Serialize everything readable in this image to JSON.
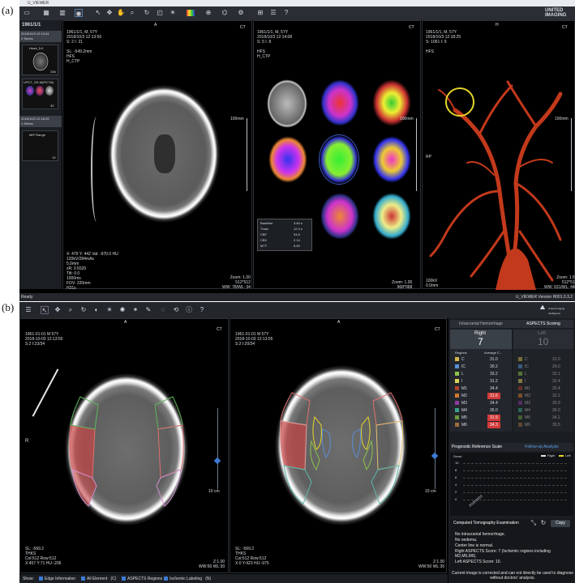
{
  "labels": {
    "a": "(a)",
    "b": "(b)"
  },
  "panel_a": {
    "app_title": "U_VIEWER",
    "brand_line1": "UNITED",
    "brand_line2": "IMAGING",
    "study_date": "1961/1/1",
    "series1": {
      "date": "2018/10/3 12:13:04",
      "count": "2 Series"
    },
    "thumbs": [
      {
        "label": "Head_5.0",
        "num": "236"
      },
      {
        "label": "UPCT_SS-M(PICTA)",
        "num": "33"
      },
      {
        "label": "MIP Range",
        "num": "13"
      }
    ],
    "series2": {
      "date": "2018/10/3 12:16:25",
      "count": "1 Series"
    },
    "view1": {
      "orient_top": "A",
      "orient_corner": "CT",
      "info": "1961/1/1, M, 57Y\n2018/10/3 12:13:56\nS: 2 I: 21\n\nSL: -549.2mm\nHFS\nH_CTP",
      "bottom_left": "X: 479 Y: 442 Val: -970.0 HU\n120kV/284mAs\n5.0mm\nzR: 0.5520\nTilt: 0.0\n1000ms\nFOV: 220mm\nH31s",
      "bottom_right": "Zoom: 1.00\n512*512\nWW: 78/WL: 34",
      "scale": "100mm"
    },
    "view2": {
      "orient_corner": "CT",
      "info": "1961/1/1, M, 57Y\n2018/10/3 12:14:08\nS: 5 I: 8\n\nHFS\nH_CTP",
      "bottom_right": "Zoom: 1.00\n968*968",
      "scale": "100mm",
      "table": [
        [
          "Baseline",
          "3.84 s"
        ],
        [
          "Tmax",
          "12.3 s"
        ],
        [
          "CBF",
          "34.8"
        ],
        [
          "CBV",
          "2.14"
        ],
        [
          "MTT",
          "6.50"
        ]
      ]
    },
    "view3": {
      "orient_top": "H",
      "orient_corner": "CT",
      "info": "1961/1/1, M, 57Y\n2018/10/3 12:18:25\nS: 1061 I: 9\n\nHFS",
      "bottom_left": "100kV\n0.0mm",
      "bottom_right": "Zoom: 1.51\n512*512\nWW: 631/WL: 444",
      "side": "RP",
      "scale": "100mm"
    },
    "status": "Ready",
    "version": "U_VIEWER Version R001.0.3.2"
  },
  "panel_b": {
    "brand": "United Imaging Intelligence",
    "left_view": {
      "orient_top": "A",
      "orient_corner": "CT",
      "info": "1961-01-01 M 57Y\n2018-10-03 12:13:55\nS:2 I:23/34",
      "side": "R",
      "scale": "10 cm",
      "bottom_left": "SL: -569.2\nTHKS\nCol:512 Row:512\nX:457 Y:71 HU:-206",
      "bottom_right": "Z:1.00\nWW:50 WL:30"
    },
    "right_view": {
      "orient_top": "A",
      "orient_corner": "CT",
      "info": "1961-01-01 M 57Y\n2018-10-03 12:13:55\nS:2 I:20/34",
      "side": "R",
      "scale": "10 cm",
      "bottom_left": "SL: -569.2\nTHKS\nCol:512 Row:512\nX:0 Y:423 HU:-975",
      "bottom_right": "Z:1.00\nWW:50 WL:30"
    },
    "tabs": [
      "Intracranial Hemorrhage",
      "ASPECTS Scoring"
    ],
    "right_score": {
      "label": "Right",
      "value": "7"
    },
    "left_score": {
      "label": "Left",
      "value": "10"
    },
    "col_headers": [
      "Regions",
      "Average C..."
    ],
    "rows_right": [
      [
        "C",
        "31.0",
        "normal"
      ],
      [
        "IC",
        "30.2",
        "normal"
      ],
      [
        "L",
        "33.2",
        "normal"
      ],
      [
        "I",
        "31.2",
        "normal"
      ],
      [
        "M1",
        "34.4",
        "normal"
      ],
      [
        "M2",
        "31.6",
        "flag"
      ],
      [
        "M3",
        "34.4",
        "normal"
      ],
      [
        "M4",
        "35.0",
        "normal"
      ],
      [
        "M5",
        "31.9",
        "flag"
      ],
      [
        "M6",
        "34.3",
        "flag"
      ]
    ],
    "rows_left": [
      [
        "C",
        "31.0"
      ],
      [
        "IC",
        "29.0"
      ],
      [
        "L",
        "33.1"
      ],
      [
        "I",
        "32.4"
      ],
      [
        "M1",
        "32.4"
      ],
      [
        "M2",
        "32.2"
      ],
      [
        "M3",
        "35.9"
      ],
      [
        "M4",
        "36.0"
      ],
      [
        "M5",
        "34.2"
      ],
      [
        "M6",
        "35.5"
      ]
    ],
    "region_colors": [
      "#d4b84a",
      "#5a8fd6",
      "#8cc34a",
      "#e0d05a",
      "#b0402a",
      "#d07a30",
      "#8a3aa0",
      "#3aa08a",
      "#6a9a3a",
      "#a06a3a"
    ],
    "prog_tabs": [
      "Prognostic Reference Scale",
      "Follow-up Analysis"
    ],
    "legend": [
      "Right",
      "Left"
    ],
    "y_ticks": [
      "10",
      "8",
      "6",
      "4",
      "2",
      "0"
    ],
    "x_tick": "2018/10/03",
    "chart_label": "Score",
    "exam_title": "Computed Tomography Examination",
    "copy_btn": "Copy",
    "report": [
      "No intracranial hemorrhage.",
      "No oedema.",
      "Center line is normal.",
      "Right ASPECTS Score: 7 (Ischemic regions including M2,M5,M6).",
      "Left ASPECTS Score: 10."
    ],
    "disclaimer": "Current image is corrected and can not directly be used to diagnose without doctors' analysis.",
    "bottom_show": "Show:",
    "checks": [
      "Edge Information",
      "All Element   (C)",
      "ASPECTS Regions",
      "Ischemic Labeling   (N)"
    ]
  }
}
